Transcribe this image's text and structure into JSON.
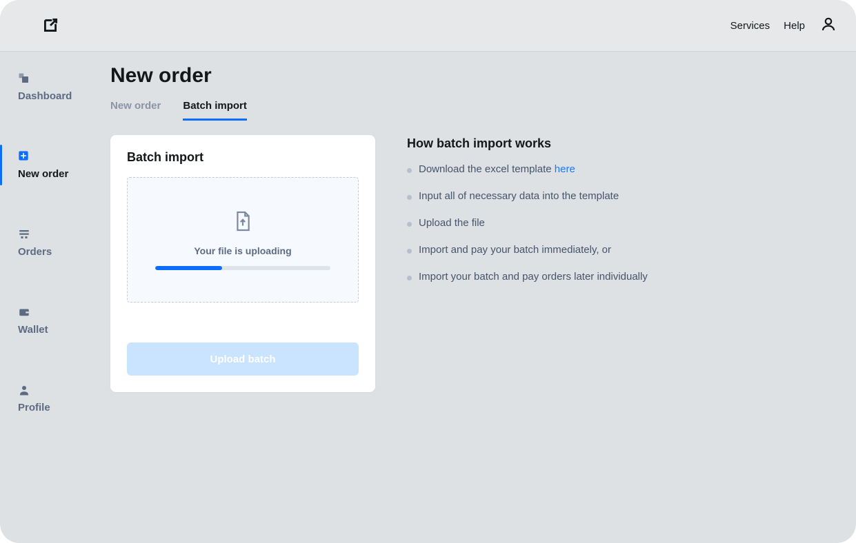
{
  "topbar": {
    "links": {
      "services": "Services",
      "help": "Help"
    }
  },
  "sidebar": {
    "items": [
      {
        "label": "Dashboard"
      },
      {
        "label": "New order"
      },
      {
        "label": "Orders"
      },
      {
        "label": "Wallet"
      },
      {
        "label": "Profile"
      }
    ]
  },
  "page": {
    "title": "New order"
  },
  "tabs": {
    "new_order": "New order",
    "batch_import": "Batch import"
  },
  "card": {
    "title": "Batch import",
    "uploading_msg": "Your file is uploading",
    "progress_percent": 38,
    "button": "Upload batch"
  },
  "info": {
    "title": "How batch import works",
    "step1_prefix": "Download the excel template ",
    "step1_link": "here",
    "step2": "Input all of necessary data into the template",
    "step3": "Upload the file",
    "step4": "Import and pay your batch immediately, or",
    "step5": "Import your batch and pay orders later individually"
  }
}
